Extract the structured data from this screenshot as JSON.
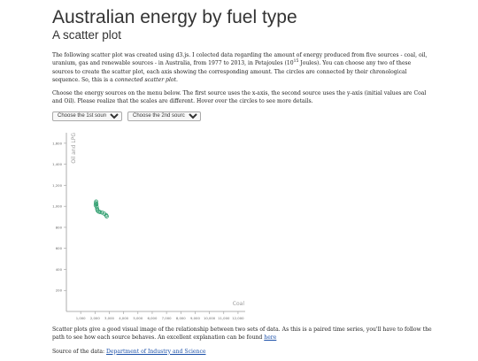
{
  "page": {
    "title": "Australian energy by fuel type",
    "subtitle": "A scatter plot",
    "intro": {
      "text1": "The following scatter plot was created using d3.js. I colected data regarding the amount of energy produced from five sources - coal, oil, uranium, gas and renewable sources - in Australia, from 1977 to 2013, in Petajoules (10",
      "sup": "15",
      "text2": " Joules). You can choose any two of these sources to create the scatter plot, each axis showing the corresponding amount. The circles are connected by their chronological sequence. So, this is a ",
      "emph": "connected scatter plot",
      "text3": "."
    },
    "instructions": "Choose the energy sources on the menu below. The first source uses the x-axis, the second source uses the y-axis (initial values are Coal and Oil). Please realize that the scales are different. Hover over the circles to see more details.",
    "select1": {
      "selected": "Choose the 1st source"
    },
    "select2": {
      "selected": "Choose the 2nd source"
    },
    "outro": {
      "text": "Scatter plots give a good visual image of the relationship between two sets of data. As this is a paired time series, you'll have to follow the path to see how each source behaves. An excellent explanation can be found ",
      "link": "here"
    },
    "source": {
      "label": "Source of the data: ",
      "link": "Department of Industry and Science"
    }
  },
  "chart_data": {
    "type": "scatter",
    "xlabel": "Coal",
    "ylabel": "Oil and LPG",
    "x_ticks": [
      1000,
      2000,
      3000,
      4000,
      5000,
      6000,
      7000,
      8000,
      9000,
      10000,
      11000,
      12000
    ],
    "x_tick_labels": [
      "1,000",
      "2,000",
      "3,000",
      "4,000",
      "5,000",
      "6,000",
      "7,000",
      "8,000",
      "9,000",
      "10,000",
      "11,000",
      "12,000"
    ],
    "y_ticks": [
      200,
      400,
      600,
      800,
      1000,
      1200,
      1400,
      1600
    ],
    "y_tick_labels": [
      "200",
      "400",
      "600",
      "800",
      "1,000",
      "1,200",
      "1,400",
      "1,600"
    ],
    "xlim": [
      0,
      12500
    ],
    "ylim": [
      0,
      1700
    ],
    "point_color": "#2e9e6e",
    "points": [
      {
        "x": 2050,
        "y": 1010
      },
      {
        "x": 2060,
        "y": 1030
      },
      {
        "x": 2080,
        "y": 1045
      },
      {
        "x": 2100,
        "y": 1020
      },
      {
        "x": 2120,
        "y": 995
      },
      {
        "x": 2150,
        "y": 975
      },
      {
        "x": 2180,
        "y": 960
      },
      {
        "x": 2250,
        "y": 950
      },
      {
        "x": 2350,
        "y": 945
      },
      {
        "x": 2500,
        "y": 940
      },
      {
        "x": 2650,
        "y": 930
      },
      {
        "x": 2780,
        "y": 915
      },
      {
        "x": 2820,
        "y": 905
      }
    ]
  }
}
